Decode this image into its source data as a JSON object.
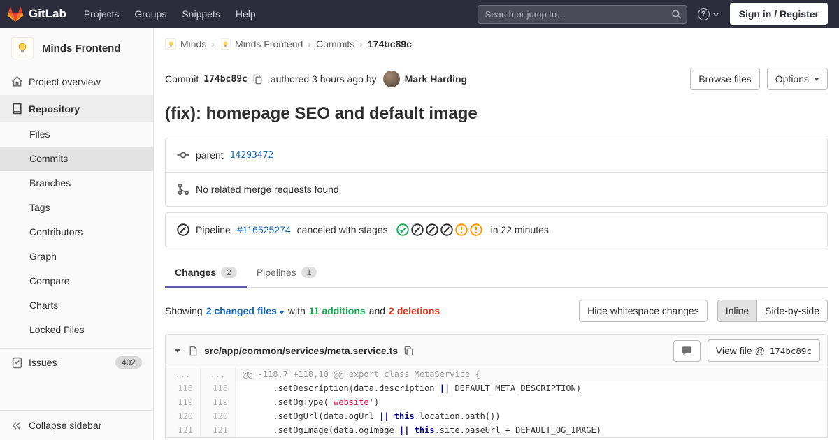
{
  "navbar": {
    "brand": "GitLab",
    "menu": [
      "Projects",
      "Groups",
      "Snippets",
      "Help"
    ],
    "search_placeholder": "Search or jump to…",
    "help_icon": "question-mark-icon",
    "sign_in_label": "Sign in / Register"
  },
  "sidebar": {
    "project_name": "Minds Frontend",
    "avatar_icon": "lightbulb-icon",
    "project_overview_label": "Project overview",
    "repository_label": "Repository",
    "repo_subitems": [
      "Files",
      "Commits",
      "Branches",
      "Tags",
      "Contributors",
      "Graph",
      "Compare",
      "Charts",
      "Locked Files"
    ],
    "issues_label": "Issues",
    "issues_count": "402",
    "collapse_label": "Collapse sidebar"
  },
  "breadcrumb": {
    "items": [
      "Minds",
      "Minds Frontend",
      "Commits",
      "174bc89c"
    ]
  },
  "commit": {
    "label": "Commit",
    "sha": "174bc89c",
    "authored_text": "authored 3 hours ago by",
    "author_name": "Mark Harding",
    "browse_files_label": "Browse files",
    "options_label": "Options",
    "title": "(fix): homepage SEO and default image",
    "parent_label": "parent",
    "parent_sha": "14293472",
    "no_mr_text": "No related merge requests found",
    "pipeline": {
      "label": "Pipeline",
      "id": "#116525274",
      "status_text": "canceled with stages",
      "overall_status": "canceled",
      "stages": [
        "success",
        "canceled",
        "canceled",
        "canceled",
        "warning",
        "warning"
      ],
      "duration_text": "in 22 minutes"
    }
  },
  "tabs": [
    {
      "label": "Changes",
      "count": "2"
    },
    {
      "label": "Pipelines",
      "count": "1"
    }
  ],
  "diff_controls": {
    "showing_label": "Showing",
    "changed_files_label": "2 changed files",
    "with_label": "with",
    "additions_label": "11 additions",
    "and_label": "and",
    "deletions_label": "2 deletions",
    "hide_whitespace_label": "Hide whitespace changes",
    "inline_label": "Inline",
    "side_by_side_label": "Side-by-side"
  },
  "diff_file": {
    "path": "src/app/common/services/meta.service.ts",
    "view_file_label": "View file @",
    "view_file_sha": "174bc89c",
    "lines": [
      {
        "type": "hunk",
        "old": "...",
        "new": "...",
        "tokens": [
          [
            "h",
            "@@ -118,7 +118,10 @@ export class MetaService {"
          ]
        ]
      },
      {
        "type": "context",
        "old": "118",
        "new": "118",
        "tokens": [
          [
            "",
            "      .setDescription(data.description "
          ],
          [
            "op",
            "||"
          ],
          [
            "",
            " DEFAULT_META_DESCRIPTION)"
          ]
        ]
      },
      {
        "type": "context",
        "old": "119",
        "new": "119",
        "tokens": [
          [
            "",
            "      .setOgType("
          ],
          [
            "s",
            "'website'"
          ],
          [
            "",
            ")"
          ]
        ]
      },
      {
        "type": "context",
        "old": "120",
        "new": "120",
        "tokens": [
          [
            "",
            "      .setOgUrl(data.ogUrl "
          ],
          [
            "op",
            "||"
          ],
          [
            "",
            " "
          ],
          [
            "k",
            "this"
          ],
          [
            "",
            ".location.path())"
          ]
        ]
      },
      {
        "type": "context",
        "old": "121",
        "new": "121",
        "tokens": [
          [
            "",
            "      .setOgImage(data.ogImage "
          ],
          [
            "op",
            "||"
          ],
          [
            "",
            " "
          ],
          [
            "k",
            "this"
          ],
          [
            "",
            ".site.baseUrl + DEFAULT_OG_IMAGE)"
          ]
        ]
      }
    ]
  },
  "colors": {
    "navbar-bg": "#2d2c3c",
    "link": "#1b69b6",
    "addition": "#1aaa55",
    "deletion": "#db3b21",
    "success": "#1aaa55",
    "canceled": "#2e2e2e",
    "warning": "#fc9403",
    "tab-indicator": "#5b5bab"
  }
}
